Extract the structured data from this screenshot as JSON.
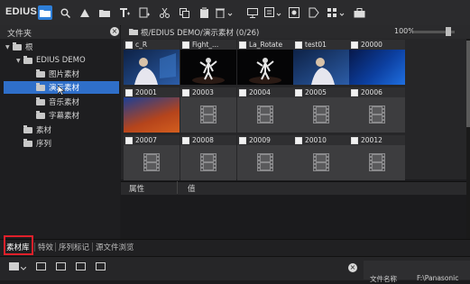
{
  "app": {
    "name": "EDIUS"
  },
  "folder_panel": {
    "title": "文件夹",
    "tree": [
      {
        "label": "根",
        "level": 0,
        "expanded": true,
        "selected": false
      },
      {
        "label": "EDIUS DEMO",
        "level": 1,
        "expanded": true,
        "selected": false
      },
      {
        "label": "图片素材",
        "level": 2,
        "selected": false
      },
      {
        "label": "演示素材",
        "level": 2,
        "selected": true
      },
      {
        "label": "音乐素材",
        "level": 2,
        "selected": false
      },
      {
        "label": "字幕素材",
        "level": 2,
        "selected": false
      },
      {
        "label": "素材",
        "level": 1,
        "selected": false
      },
      {
        "label": "序列",
        "level": 1,
        "selected": false
      }
    ]
  },
  "clip_browser": {
    "path": "根/EDIUS DEMO/演示素材 (0/26)",
    "zoom": "100%",
    "clips": [
      {
        "name": "c_R",
        "thumb": "singer"
      },
      {
        "name": "Fight_...",
        "thumb": "dancer"
      },
      {
        "name": "La_Rotate",
        "thumb": "dancer"
      },
      {
        "name": "test01",
        "thumb": "singer"
      },
      {
        "name": "20000",
        "thumb": "blue"
      },
      {
        "name": "20001",
        "thumb": "red"
      },
      {
        "name": "20003",
        "thumb": "film"
      },
      {
        "name": "20004",
        "thumb": "film"
      },
      {
        "name": "20005",
        "thumb": "film"
      },
      {
        "name": "20006",
        "thumb": "film"
      },
      {
        "name": "20007",
        "thumb": "film"
      },
      {
        "name": "20008",
        "thumb": "film"
      },
      {
        "name": "20009",
        "thumb": "film"
      },
      {
        "name": "20010",
        "thumb": "film"
      },
      {
        "name": "20012",
        "thumb": "film"
      }
    ]
  },
  "properties": {
    "attr_header": "属性",
    "value_header": "值"
  },
  "tabs": [
    {
      "label": "素材库",
      "active": true
    },
    {
      "label": "特效",
      "active": false
    },
    {
      "label": "序列标记",
      "active": false
    },
    {
      "label": "源文件浏览",
      "active": false
    }
  ],
  "bottom_panel": {
    "file_name_label": "文件名称",
    "file_name_value": "F:\\Panasonic"
  },
  "colors": {
    "accent": "#2f7fd8",
    "selection": "#2f6fc9",
    "highlight_box": "#e0202a"
  }
}
